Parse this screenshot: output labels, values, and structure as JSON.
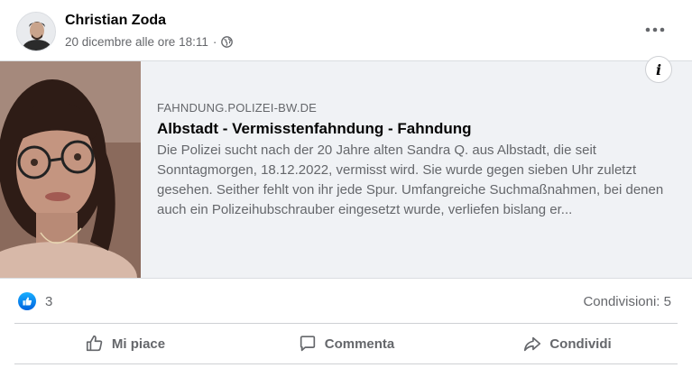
{
  "post": {
    "author": "Christian Zoda",
    "timestamp": "20 dicembre alle ore 18:11",
    "separator": "·",
    "privacy_icon": "globe-icon",
    "menu_icon": "more-horizontal-icon"
  },
  "link": {
    "domain": "FAHNDUNG.POLIZEI-BW.DE",
    "title": "Albstadt - Vermisstenfahndung - Fahndung",
    "description": "Die Polizei sucht nach der 20 Jahre alten Sandra Q. aus Albstadt, die seit Sonntagmorgen, 18.12.2022, vermisst wird. Sie wurde gegen sieben Uhr zuletzt gesehen. Seither fehlt von ihr jede Spur. Umfangreiche Suchmaßnahmen, bei denen auch ein Polizeihubschrauber eingesetzt wurde, verliefen bislang er...",
    "info_label": "i"
  },
  "stats": {
    "reaction_count": "3",
    "shares": "Condivisioni: 5"
  },
  "actions": {
    "like": "Mi piace",
    "comment": "Commenta",
    "share": "Condividi"
  },
  "colors": {
    "secondary_text": "#65676b",
    "card_bg": "#f0f2f5",
    "like_blue": "#0062df"
  }
}
